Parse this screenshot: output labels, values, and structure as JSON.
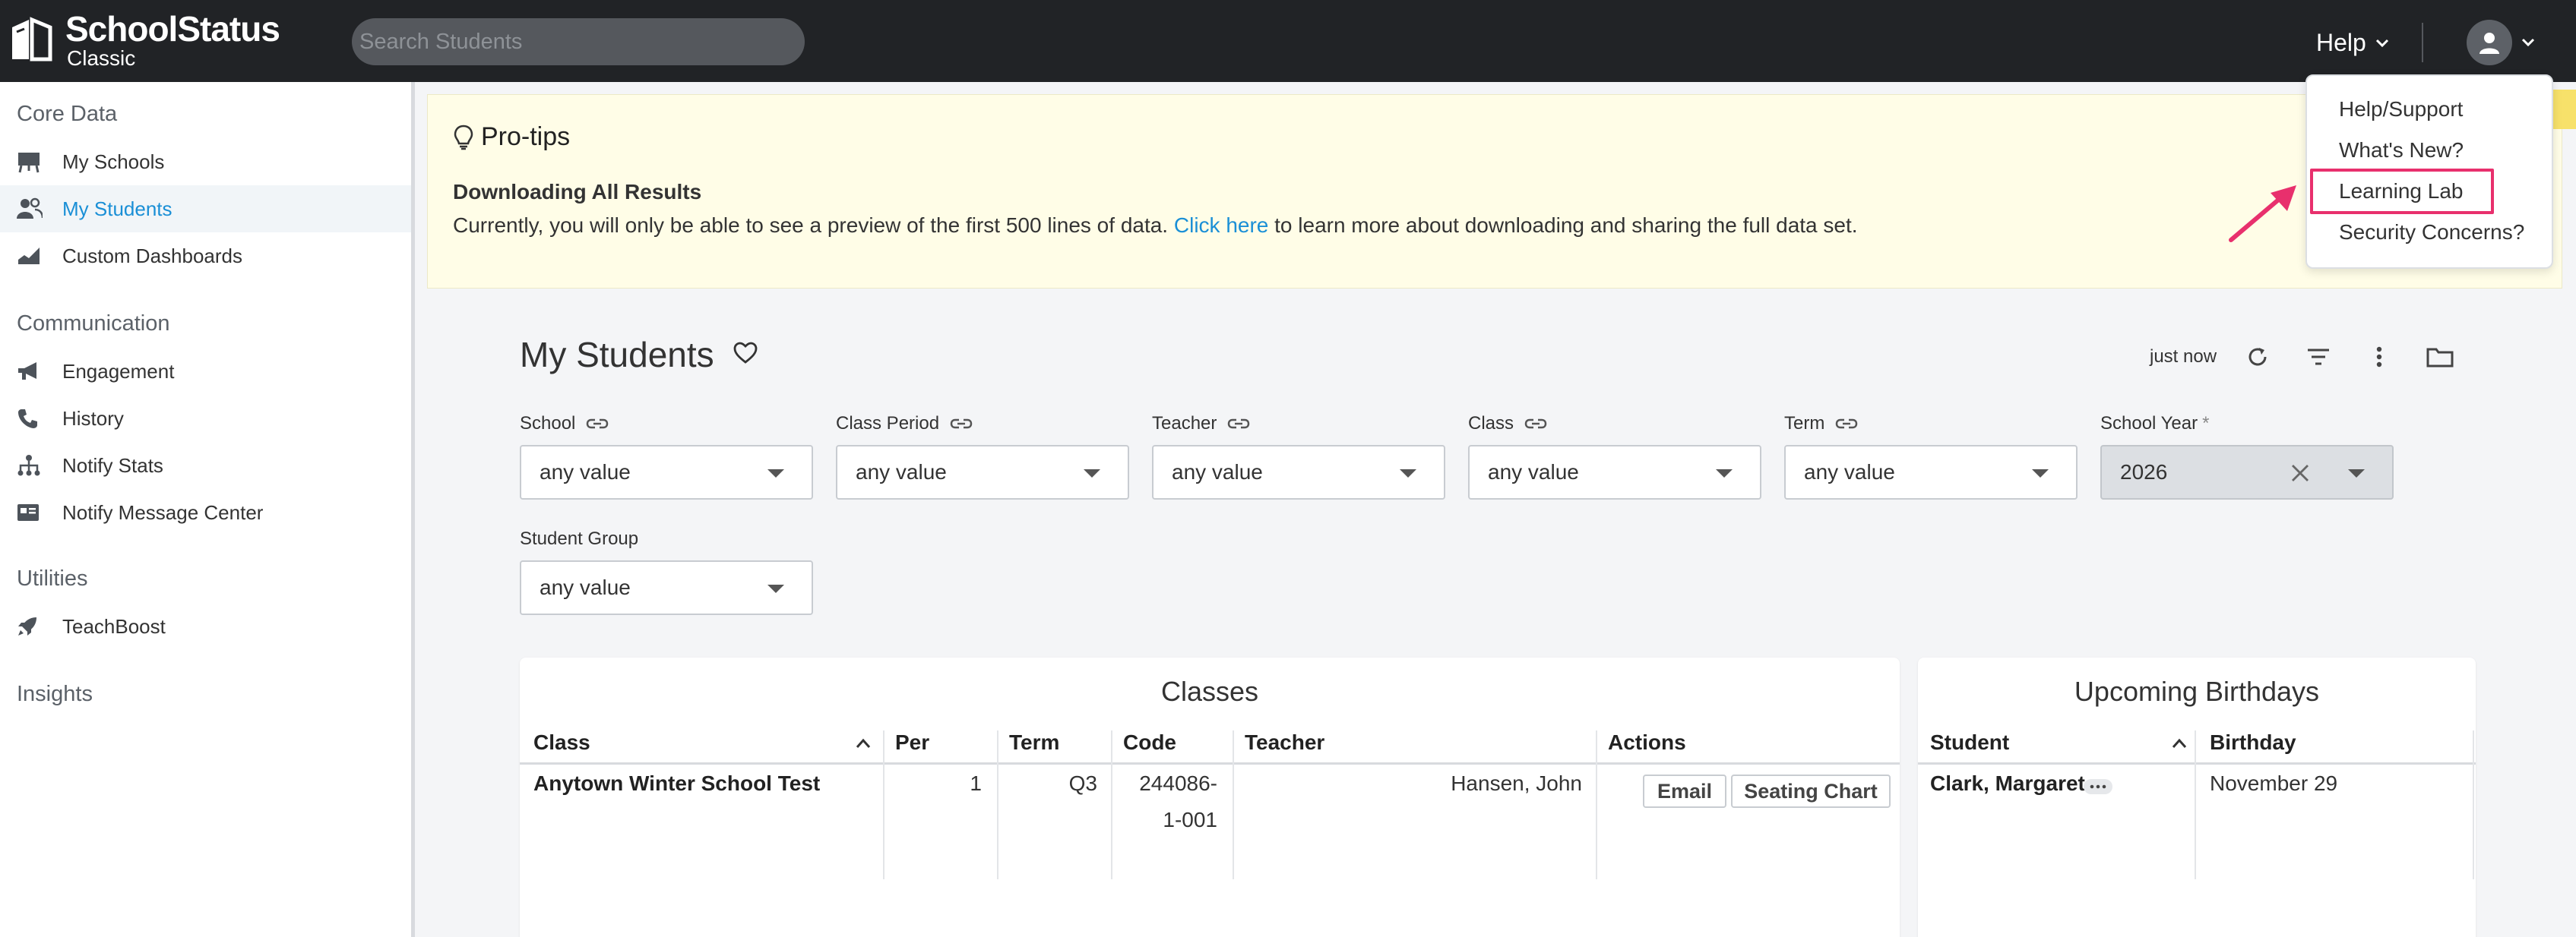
{
  "header": {
    "logo_title": "SchoolStatus",
    "logo_subtitle": "Classic",
    "search_placeholder": "Search Students",
    "help_label": "Help"
  },
  "help_menu": {
    "items": [
      "Help/Support",
      "What's New?",
      "Learning Lab",
      "Security Concerns?"
    ],
    "highlighted": "Learning Lab",
    "highlight_color": "#e8306d"
  },
  "sidebar": {
    "sections": [
      {
        "title": "Core Data",
        "items": [
          {
            "label": "My Schools",
            "icon": "school-board-icon"
          },
          {
            "label": "My Students",
            "icon": "students-icon",
            "active": true
          },
          {
            "label": "Custom Dashboards",
            "icon": "dashboard-chart-icon"
          }
        ]
      },
      {
        "title": "Communication",
        "items": [
          {
            "label": "Engagement",
            "icon": "megaphone-icon"
          },
          {
            "label": "History",
            "icon": "phone-icon"
          },
          {
            "label": "Notify Stats",
            "icon": "hierarchy-icon"
          },
          {
            "label": "Notify Message Center",
            "icon": "message-card-icon"
          }
        ]
      },
      {
        "title": "Utilities",
        "items": [
          {
            "label": "TeachBoost",
            "icon": "rocket-icon"
          }
        ]
      },
      {
        "title": "Insights",
        "items": []
      }
    ]
  },
  "protips": {
    "title": "Pro-tips",
    "subtitle": "Downloading All Results",
    "text_before": "Currently, you will only be able to see a preview of the first 500 lines of data. ",
    "link_text": "Click here",
    "text_after": " to learn more about downloading and sharing the full data set."
  },
  "page": {
    "title": "My Students",
    "updated": "just now"
  },
  "filters": [
    {
      "label": "School",
      "value": "any value"
    },
    {
      "label": "Class Period",
      "value": "any value"
    },
    {
      "label": "Teacher",
      "value": "any value"
    },
    {
      "label": "Class",
      "value": "any value"
    },
    {
      "label": "Term",
      "value": "any value"
    },
    {
      "label": "School Year",
      "required": "*",
      "value": "2026"
    },
    {
      "label": "Student Group",
      "value": "any value"
    }
  ],
  "classes": {
    "title": "Classes",
    "columns": [
      "Class",
      "Per",
      "Term",
      "Code",
      "Teacher",
      "Actions"
    ],
    "rows": [
      {
        "class": "Anytown Winter School Test",
        "per": "1",
        "term": "Q3",
        "code_line1": "244086-",
        "code_line2": "1-001",
        "teacher": "Hansen, John",
        "action_email": "Email",
        "action_seating": "Seating Chart"
      }
    ]
  },
  "birthdays": {
    "title": "Upcoming Birthdays",
    "columns": [
      "Student",
      "Birthday"
    ],
    "rows": [
      {
        "student": "Clark, Margaret",
        "birthday": "November 29"
      }
    ]
  },
  "colors": {
    "topbar": "#212326",
    "accent": "#1a8fd6",
    "protips_bg": "#fffde7"
  }
}
